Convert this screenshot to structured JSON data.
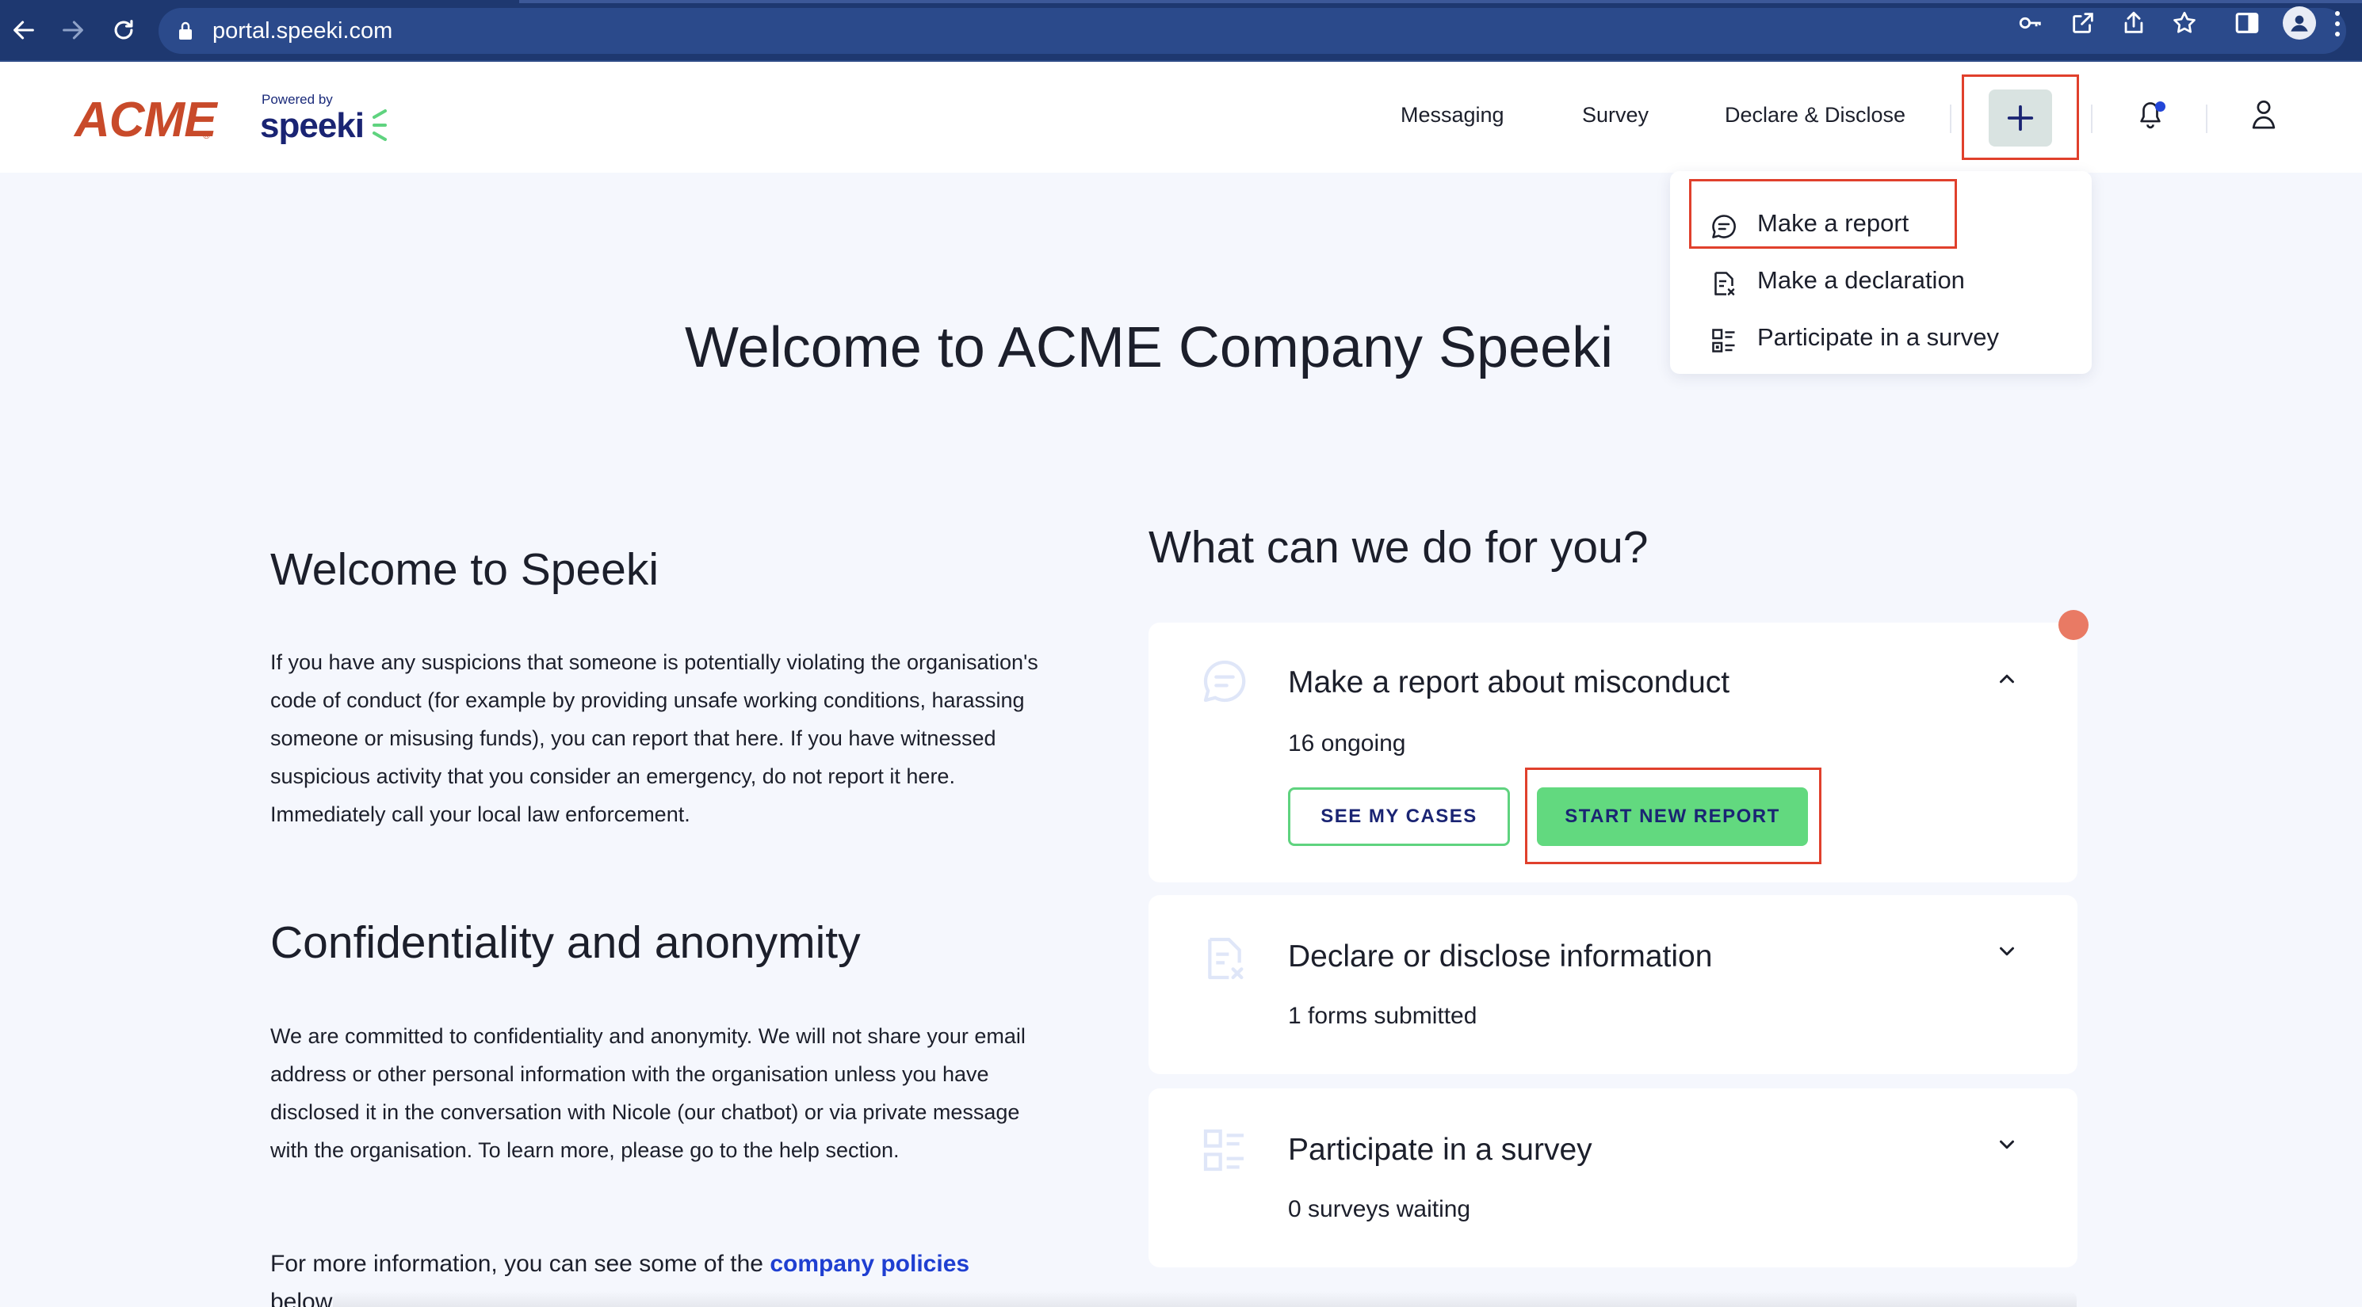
{
  "browser": {
    "url": "portal.speeki.com"
  },
  "header": {
    "company_logo": "ACME",
    "company_reg": "®",
    "powered_by": "Powered by",
    "brand": "speeki",
    "nav": [
      "Messaging",
      "Survey",
      "Declare & Disclose"
    ]
  },
  "dropdown": {
    "items": [
      "Make a report",
      "Make a declaration",
      "Participate in a survey"
    ]
  },
  "main": {
    "title": "Welcome to ACME Company Speeki",
    "left": {
      "heading1": "Welcome to Speeki",
      "para1": "If you have any suspicions that someone is potentially violating the organisation's code of conduct (for example by providing unsafe working conditions, harassing someone or misusing funds), you can report that here. If you have witnessed suspicious activity that you consider an emergency, do not report it here. Immediately call your local law enforcement.",
      "heading2": "Confidentiality and anonymity",
      "para2": "We are committed to confidentiality and anonymity. We will not share your email address or other personal information with the organisation unless you have disclosed it in the conversation with Nicole (our chatbot) or via private message with the organisation. To learn more, please go to the help section.",
      "para3_prefix": "For more information, you can see some of the",
      "para3_link": "company policies",
      "para3_suffix": "below."
    },
    "right": {
      "heading": "What can we do for you?",
      "cards": [
        {
          "title": "Make a report about misconduct",
          "subtitle": "16 ongoing",
          "secondary_button": "SEE MY CASES",
          "primary_button": "START NEW REPORT",
          "expanded": true
        },
        {
          "title": "Declare or disclose information",
          "subtitle": "1 forms submitted",
          "expanded": false
        },
        {
          "title": "Participate in a survey",
          "subtitle": "0 surveys waiting",
          "expanded": false
        }
      ]
    }
  },
  "colors": {
    "highlight_frame": "#e0402c",
    "primary_green": "#62d97f",
    "browser_bar": "#1e3870",
    "link": "#1f3fd1"
  }
}
